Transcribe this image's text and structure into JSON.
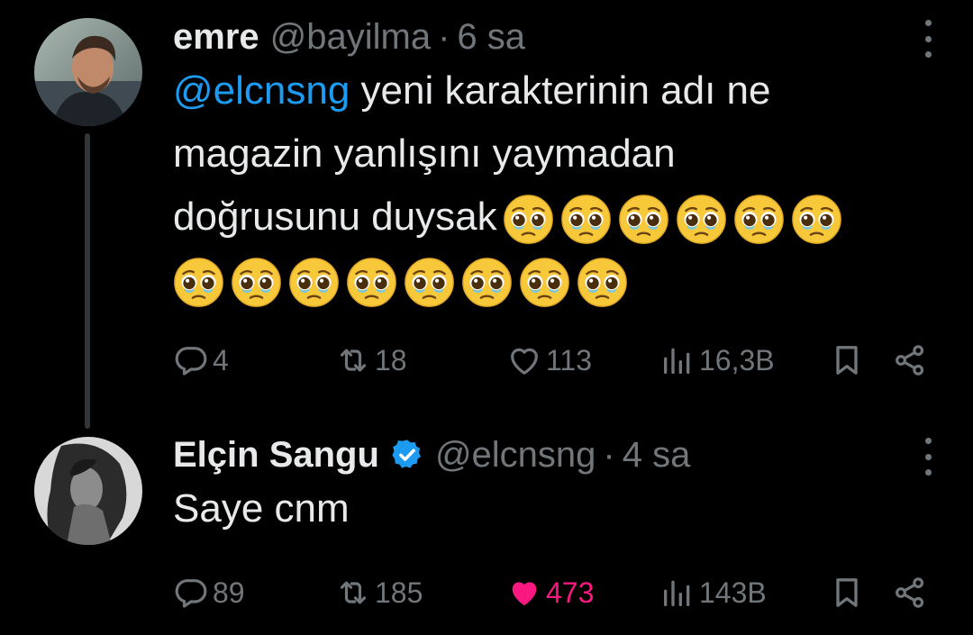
{
  "tweets": [
    {
      "author_name": "emre",
      "handle": "@bayilma",
      "separator": "·",
      "time": "6 sa",
      "mention": "@elcnsng",
      "text_line1": " yeni karakterinin adı ne",
      "text_line2": "magazin yanlışını yaymadan",
      "text_line3": "doğrusunu duysak",
      "emoji_name": "pleading-face",
      "emoji_count_line3": 6,
      "emoji_count_line4": 8,
      "replies": "4",
      "reposts": "18",
      "likes": "113",
      "views": "16,3B",
      "liked": false
    },
    {
      "author_name": "Elçin Sangu",
      "verified": true,
      "handle": "@elcnsng",
      "separator": "·",
      "time": "4 sa",
      "text": "Saye cnm",
      "replies": "89",
      "reposts": "185",
      "likes": "473",
      "views": "143B",
      "liked": true
    }
  ],
  "colors": {
    "background": "#000000",
    "text": "#e7e9ea",
    "secondary": "#71767b",
    "link": "#1d9bf0",
    "like_active": "#f91880",
    "verified": "#1d9bf0"
  },
  "icons": [
    "more-icon",
    "reply-icon",
    "repost-icon",
    "like-icon",
    "views-icon",
    "bookmark-icon",
    "share-icon",
    "verified-icon"
  ]
}
